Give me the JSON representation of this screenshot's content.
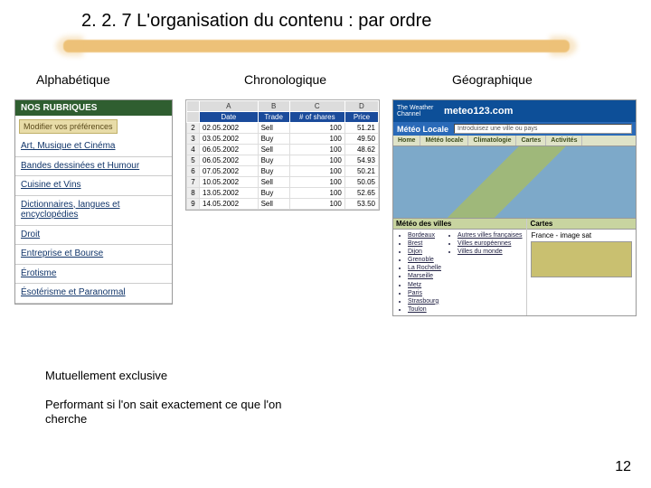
{
  "title": "2. 2. 7 L'organisation du contenu : par ordre",
  "columns": {
    "alpha": "Alphabétique",
    "chrono": "Chronologique",
    "geo": "Géographique"
  },
  "alpha": {
    "heading": "NOS RUBRIQUES",
    "pref": "Modifier vos préférences",
    "items": [
      "Art, Musique et Cinéma",
      "Bandes dessinées et Humour",
      "Cuisine et Vins",
      "Dictionnaires, langues et encyclopédies",
      "Droit",
      "Entreprise et Bourse",
      "Érotisme",
      "Ésotérisme et Paranormal"
    ]
  },
  "chrono": {
    "letterCols": [
      "",
      "A",
      "B",
      "C",
      "D"
    ],
    "headers": [
      "",
      "Date",
      "Trade",
      "# of shares",
      "Price"
    ],
    "rows": [
      [
        "2",
        "02.05.2002",
        "Sell",
        "100",
        "51.21"
      ],
      [
        "3",
        "03.05.2002",
        "Buy",
        "100",
        "49.50"
      ],
      [
        "4",
        "06.05.2002",
        "Sell",
        "100",
        "48.62"
      ],
      [
        "5",
        "06.05.2002",
        "Buy",
        "100",
        "54.93"
      ],
      [
        "6",
        "07.05.2002",
        "Buy",
        "100",
        "50.21"
      ],
      [
        "7",
        "10.05.2002",
        "Sell",
        "100",
        "50.05"
      ],
      [
        "8",
        "13.05.2002",
        "Buy",
        "100",
        "52.65"
      ],
      [
        "9",
        "14.05.2002",
        "Sell",
        "100",
        "53.50"
      ]
    ]
  },
  "geo": {
    "logo": "The Weather Channel",
    "brand": "meteo123.com",
    "subTitle": "Météo Locale",
    "search": "Introduisez une ville ou pays",
    "tabs": [
      "Home",
      "Météo locale",
      "Climatologie",
      "Cartes",
      "Activités"
    ],
    "panelCities": {
      "title": "Météo des villes",
      "left": [
        "Bordeaux",
        "Brest",
        "Dijon",
        "Grenoble",
        "La Rochelle",
        "Marseille",
        "Metz",
        "Paris",
        "Strasbourg",
        "Toulon"
      ],
      "right": [
        "Autres villes françaises",
        "Villes européennes",
        "Villes du monde"
      ]
    },
    "panelMaps": {
      "title": "Cartes",
      "label": "France - image sat"
    }
  },
  "notes": {
    "n1": "Mutuellement exclusive",
    "n2": "Performant si l'on sait exactement ce que l'on cherche"
  },
  "pageNumber": "12"
}
